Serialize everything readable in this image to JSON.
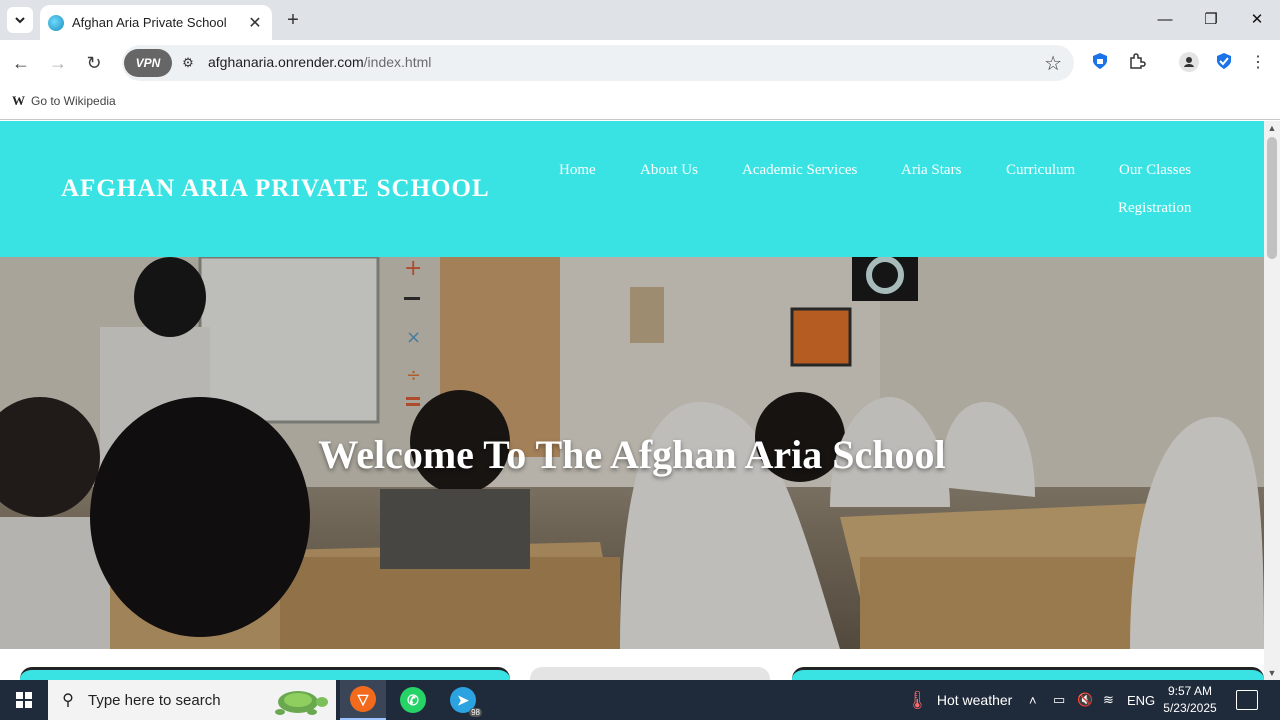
{
  "browser": {
    "tab_title": "Afghan Aria Private School",
    "url_host": "afghanaria.onrender.com",
    "url_path": "/index.html",
    "vpn_label": "VPN",
    "bookmark_label": "Go to Wikipedia",
    "bookmark_glyph": "W"
  },
  "site": {
    "logo": "AFGHAN ARIA PRIVATE SCHOOL",
    "nav": [
      "Home",
      "About Us",
      "Academic Services",
      "Aria Stars",
      "Curriculum",
      "Our Classes",
      "Registration"
    ],
    "hero_title": "Welcome To The Afghan Aria School",
    "header_color": "#3ae3e3"
  },
  "taskbar": {
    "search_placeholder": "Type here to search",
    "weather": "Hot weather",
    "language": "ENG",
    "time": "9:57 AM",
    "date": "5/23/2025",
    "telegram_badge": "98"
  }
}
